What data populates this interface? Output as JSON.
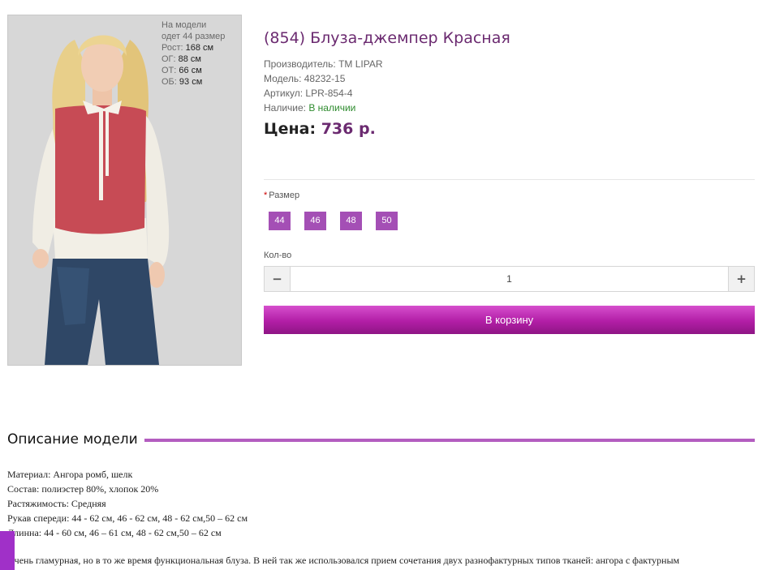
{
  "product": {
    "title": "(854) Блуза-джемпер Красная",
    "manufacturer": "Производитель: ТМ LIPAR",
    "model": "Модель: 48232-15",
    "sku": "Артикул: LPR-854-4",
    "availability_label": "Наличие: ",
    "availability_value": "В наличии",
    "price_label": "Цена:",
    "price_value": "736 р."
  },
  "image_caption": {
    "line1": "На модели",
    "line2": "одет 44 размер",
    "height_label": "Рост:",
    "height_value": "168 см",
    "chest_label": "ОГ:",
    "chest_value": "88 см",
    "waist_label": "ОТ:",
    "waist_value": "66 см",
    "hips_label": "ОБ:",
    "hips_value": "93 см"
  },
  "options": {
    "required_mark": "*",
    "size_label": "Размер",
    "sizes": [
      "44",
      "46",
      "48",
      "50"
    ]
  },
  "quantity": {
    "label": "Кол-во",
    "value": "1",
    "minus": "−",
    "plus": "+"
  },
  "cart_button": "В корзину",
  "description": {
    "heading": "Описание модели",
    "lines": [
      "Материал: Ангора ромб, шелк",
      "Состав: полиэстер 80%, хлопок 20%",
      "Растяжимость: Средняя",
      "Рукав спереди: 44 - 62 см, 46 - 62 см, 48 - 62 см,50 – 62 см",
      "Длинна: 44 - 60 см, 46 – 61 см, 48 - 62 см,50 – 62 см"
    ],
    "paragraph": "Очень гламурная, но в то же время функциональная блуза. В ней так же использовался прием сочетания двух разнофактурных типов тканей: ангора с фактурным"
  },
  "colors": {
    "accent": "#a44fb5",
    "title": "#6b2a70",
    "cart_button": "#b21ea6",
    "in_stock": "#2e8b2e"
  }
}
